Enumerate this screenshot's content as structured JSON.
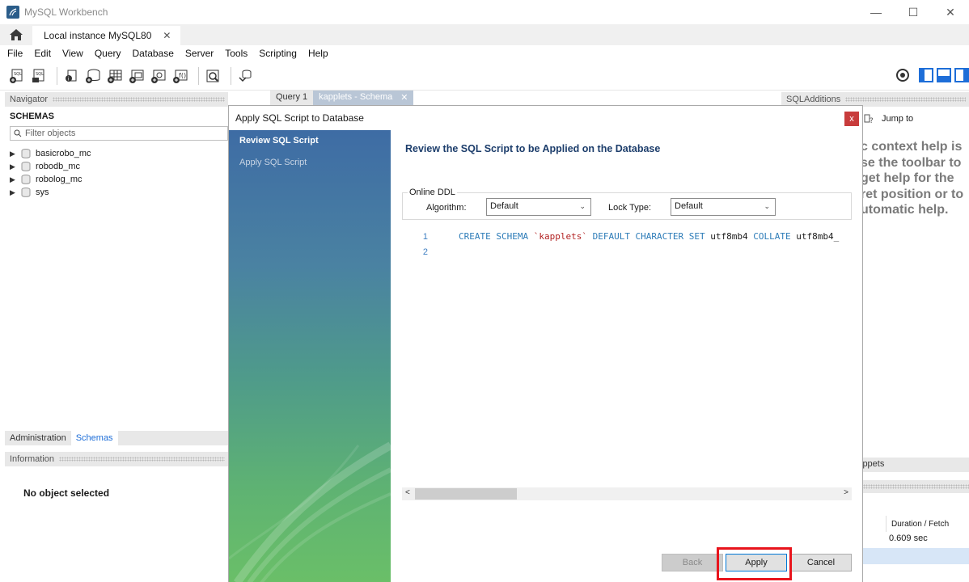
{
  "window": {
    "title": "MySQL Workbench",
    "minimize": "—",
    "maximize": "☐",
    "close": "✕"
  },
  "connection_tab": {
    "label": "Local instance MySQL80",
    "close": "✕"
  },
  "menu": [
    "File",
    "Edit",
    "View",
    "Query",
    "Database",
    "Server",
    "Tools",
    "Scripting",
    "Help"
  ],
  "navigator": {
    "header": "Navigator",
    "schemas_label": "SCHEMAS",
    "filter_placeholder": "Filter objects",
    "schemas": [
      "basicrobo_mc",
      "robodb_mc",
      "robolog_mc",
      "sys"
    ],
    "tabs": [
      "Administration",
      "Schemas"
    ],
    "info_header": "Information",
    "no_object": "No object selected"
  },
  "editor_tabs": {
    "query": "Query 1",
    "schema": "kapplets - Schema",
    "schema_close": "✕"
  },
  "sql_additions": {
    "header": "SQLAdditions",
    "jump_to": "Jump to",
    "help_lines": [
      "c context help is",
      "se the toolbar to",
      "get help for the",
      "ret position or to",
      "utomatic help."
    ],
    "snippets": "ippets",
    "duration_header": "Duration / Fetch",
    "duration_value": "0.609 sec"
  },
  "dialog": {
    "title": "Apply SQL Script to Database",
    "close": "x",
    "steps": [
      "Review SQL Script",
      "Apply SQL Script"
    ],
    "heading": "Review the SQL Script to be Applied on the Database",
    "online_ddl": {
      "legend": "Online DDL",
      "algorithm_label": "Algorithm:",
      "algorithm_value": "Default",
      "lock_label": "Lock Type:",
      "lock_value": "Default"
    },
    "script": {
      "line_numbers": [
        "1",
        "2"
      ],
      "tokens": {
        "create_schema": "CREATE SCHEMA",
        "schema_name": "`kapplets`",
        "default_charset": "DEFAULT CHARACTER SET",
        "charset": "utf8mb4",
        "collate": "COLLATE",
        "collation": "utf8mb4_"
      }
    },
    "buttons": {
      "back": "Back",
      "apply": "Apply",
      "cancel": "Cancel"
    }
  },
  "colors": {
    "highlight": "#e8141c",
    "accent": "#1e6ed8",
    "heading": "#1c3d6b"
  }
}
